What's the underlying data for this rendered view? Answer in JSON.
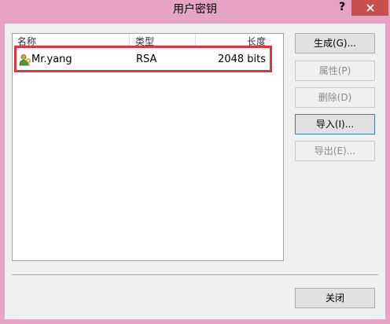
{
  "window": {
    "title": "用户密钥",
    "help": "?",
    "close_icon": "close-icon"
  },
  "list": {
    "columns": [
      "名称",
      "类型",
      "长度"
    ],
    "rows": [
      {
        "icon": "user-key-icon",
        "name": "Mr.yang",
        "type": "RSA",
        "length": "2048 bits"
      }
    ]
  },
  "buttons": {
    "generate": "生成(G)...",
    "properties": "属性(P)",
    "delete": "删除(D)",
    "import": "导入(I)...",
    "export": "导出(E)...",
    "close": "关闭"
  },
  "colors": {
    "frame": "#e6a3c4",
    "close_button": "#c7504c",
    "highlight": "#e0353a"
  }
}
